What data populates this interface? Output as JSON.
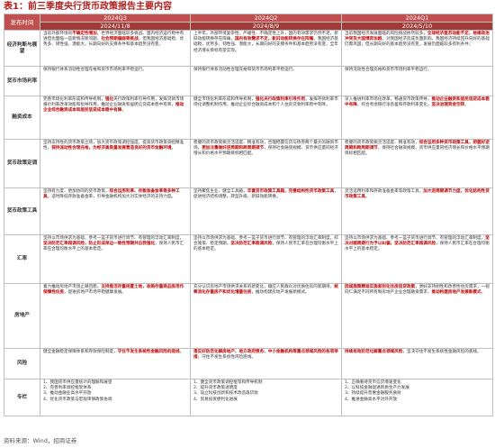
{
  "title": "表1：前三季度央行货币政策报告主要内容",
  "columns": [
    {
      "quarter": "2024Q3",
      "date": "2024/11/8"
    },
    {
      "quarter": "2024Q2",
      "date": "2024/8/9"
    },
    {
      "quarter": "2024Q1",
      "date": "2024/5/10"
    }
  ],
  "header_label": "发布时间",
  "rows": [
    {
      "label": "经济判断与展望",
      "cells": [
        [
          {
            "t": "当前外部环境的"
          },
          {
            "t": "不确定性增加",
            "h": true
          },
          {
            "t": "，世界经济面临较多挑战。国内经济运行稳中有进但也面临一些新情况新问题，"
          },
          {
            "t": "社会预期偏弱等挑战",
            "h": true
          },
          {
            "t": "，但我国经济基础稳、优势多、韧性强、潜能大，长期向好的支撑条件和基本趋势没有变。"
          }
        ],
        [
          {
            "t": "上半年，外部环境复杂性、严峻性、不确定性上升，国内有效需求仍然不足，新旧动能转换存在阵痛，"
          },
          {
            "t": "国内有效需求不足，新旧动能转换存在阵痛",
            "h": true
          },
          {
            "t": "。我国经济基础稳、优势多、韧性强、潜能大，长期向好的支撑条件和基本趋势没有变，全年经济增长目标有望实现。"
          }
        ],
        [
          {
            "t": "当前我国经济发展面临的风险挑战依然较多，"
          },
          {
            "t": "全球经济复苏动能不足，地缘政治冲突及大国博弈加剧",
            "h": true
          },
          {
            "t": "，对我国经济造成负面影响。我国经济持续回升向好的基础仍需巩固，但长期向好的基本趋势没有变，发展仍面临较多有利条件。"
          }
        ]
      ]
    },
    {
      "label": "货币市场利率",
      "cells": [
        [
          {
            "t": "保持银行体系流动性合理充裕和货币市场利率平稳运行。"
          }
        ],
        [
          {
            "t": "保持银行体系流动性合理充裕和货币市场利率平稳运行。"
          }
        ],
        [
          {
            "t": "保持流动性合理充裕和货币市场利率平稳运行。"
          }
        ]
      ]
    },
    {
      "label": "融资成本",
      "cells": [
        [
          {
            "t": "完善市场化利率形成和传导机制，"
          },
          {
            "t": "强化",
            "h": true
          },
          {
            "t": "央行政策利率引导作用，发挥贷款市场报价利率改革效能和指导作用，推动企业融资和居民信贷成本稳中有降，"
          },
          {
            "t": "推动企业综合融资成本和居民信贷成本稳中有降",
            "h": true
          },
          {
            "t": "。"
          }
        ],
        [
          {
            "t": "健全市场化利率形成和传导机制，"
          },
          {
            "t": "强化央行政策利率引导作用",
            "h": true
          },
          {
            "t": "，发挥存款利率市场化调整机制作用，推动企业综合融资成本和个人住房贷款利率稳中有降。"
          }
        ],
        [
          {
            "t": "深入推进利率市场化改革，畅通货币政策传导，"
          },
          {
            "t": "推动企业融资和居民信贷成本稳中有降",
            "h": true
          },
          {
            "t": "，综合考虑银行净息差和存款利率变化，"
          },
          {
            "t": "坚决治理资金空转",
            "h": true
          },
          {
            "t": "。"
          }
        ]
      ]
    },
    {
      "label": "货币政策定调",
      "cells": [
        [
          {
            "t": "坚持支持性的货币政策立场，加大货币政策调控强度，提高货币政策调控精准性，"
          },
          {
            "t": "保持流动性合理充裕，为经济高质量发展营造良好的货币金融环境",
            "h": true
          },
          {
            "t": "。"
          }
        ],
        [
          {
            "t": "稳健的货币政策要灵活适度、精准有效，合理把握信贷与债券两个最大的融资市场，"
          },
          {
            "t": "更加注重做好逆周期和跨周期调节",
            "h": true
          },
          {
            "t": "，保持社会融资规模、货币供应量同经济增长和价格水平预期目标相匹配。"
          }
        ],
        [
          {
            "t": "稳健的货币政策要灵活适度、精准有效，"
          },
          {
            "t": "综合运用多种货币政策工具，把握好逆周期和跨周期调节",
            "h": true
          },
          {
            "t": "，保持社会融资规模、货币供应量同经济增长和价格水平预期目标相匹配。"
          }
        ]
      ]
    },
    {
      "label": "货币政策工具",
      "cells": [
        [
          {
            "t": "坚持有力度、更加协同的货币政策，"
          },
          {
            "t": "综合运用利率、存款准备金率等多种工具",
            "h": true
          },
          {
            "t": "，适时降低存款准备金率，引导金融机构加大对实体经济的支持力度。"
          }
        ],
        [
          {
            "t": "坚持聚焦主业、健全工具箱，"
          },
          {
            "t": "丰富货币政策工具箱，完善结构性货币政策工具",
            "h": true
          },
          {
            "t": "，促进经济结构调整、转型升级、新旧动能转换。"
          }
        ],
        [
          {
            "t": "灵活运用利率和存款准备金率等政策工具，"
          },
          {
            "t": "加大逆周期调节力度，优化结构性货币政策工具",
            "h": true
          },
          {
            "t": "。"
          }
        ]
      ]
    },
    {
      "label": "汇率",
      "cells": [
        [
          {
            "t": "坚持以市场供求为基础、参考一篮子货币进行调节、有管理的浮动汇率制度，"
          },
          {
            "t": "坚决防范汇率超调风险，防止形成单边一致性预期并自我强化",
            "h": true
          },
          {
            "t": "，保持人民币汇率在合理均衡水平上的基本稳定。"
          }
        ],
        [
          {
            "t": "坚持以市场供求为基础、参考一篮子货币进行调节、有管理的浮动汇率制度，综合施策、稳定预期，"
          },
          {
            "t": "坚决防范汇率超调风险",
            "h": true
          },
          {
            "t": "，保持人民币汇率在合理均衡水平上的基本稳定。"
          }
        ],
        [
          {
            "t": "坚持以市场供求为基础、参考一篮子货币进行调节、有管理的浮动汇率制度，"
          },
          {
            "t": "坚决对顺周期行为予以纠偏，坚决防范汇率超调风险",
            "h": true
          },
          {
            "t": "，保持人民币汇率在合理均衡水平上的基本稳定。"
          }
        ]
      ]
    },
    {
      "label": "房地产",
      "cells": [
        [
          {
            "t": "着力推动房地产市场止跌回稳，"
          },
          {
            "t": "支持盘活存量闲置土地，收购存量商品房用作保障性住房",
            "h": true
          },
          {
            "t": "，促进房地产市场平稳健康发展。"
          }
        ],
        [
          {
            "t": "充分认识房地产市场供求关系的新变化，顺应人民群众对优质住房的新期待，"
          },
          {
            "t": "统筹消化存量房产和优化增量住房",
            "h": true
          },
          {
            "t": "，推动构建房地产发展新模式。"
          }
        ],
        [
          {
            "t": "因城施策精准实施差别化住房信贷政策",
            "h": true
          },
          {
            "t": "，更好支持刚性和改善性住房需求，一视同仁满足不同所有制房地产企业合理融资需求，"
          },
          {
            "t": "推动构建房地产发展新模式",
            "h": true
          },
          {
            "t": "。"
          }
        ]
      ]
    },
    {
      "label": "风险",
      "cells": [
        [
          {
            "t": "健全金融稳定保障体系和存款保险制度，"
          },
          {
            "t": "守住不发生系统性金融风险的底线",
            "h": true
          },
          {
            "t": "。"
          }
        ],
        [
          {
            "t": "落实好防范化解房地产、地方政府债务、中小金融机构等重点领域风险的各项举措",
            "h": true
          },
          {
            "t": "，守住不发生系统性风险底线。"
          }
        ],
        [
          {
            "t": "持续有效防范化解重点领域风险",
            "h": true
          },
          {
            "t": "，坚决守住不发生系统性金融风险的底线。"
          }
        ]
      ]
    },
    {
      "label": "专栏",
      "cells": [
        [
          {
            "t": "1、我国货币供应量统计的理解和展望"
          },
          {
            "t": "\n2、完善利率调控框架体系"
          },
          {
            "t": "\n3、推动金融业高水平开放"
          },
          {
            "t": "\n4、优化货币政策与宏观审慎政策协调"
          }
        ],
        [
          {
            "t": "1、健全货币政策调控框架和传导机制"
          },
          {
            "t": "\n2、提升货币政策透明度"
          },
          {
            "t": "\n3、设立科技创新和技术改造再贷款"
          },
          {
            "t": "\n4、贸易投资便利化进展"
          }
        ],
        [
          {
            "t": "1、正确看待货币信贷增速变化"
          },
          {
            "t": "\n2、以科技金融促进新质生产力发展"
          },
          {
            "t": "\n3、持续提升普惠金融服务质效"
          },
          {
            "t": "\n4、推进金融高水平对外开放"
          }
        ]
      ]
    }
  ],
  "source": "资料来源：Wind，招商证券"
}
